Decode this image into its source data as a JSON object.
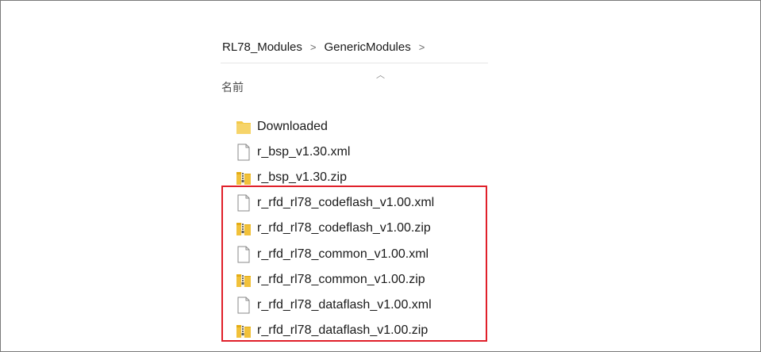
{
  "breadcrumb": {
    "items": [
      "RL78_Modules",
      "GenericModules"
    ],
    "separator": ">"
  },
  "column_header": {
    "name": "名前"
  },
  "files": [
    {
      "name": "Downloaded",
      "type": "folder"
    },
    {
      "name": "r_bsp_v1.30.xml",
      "type": "xml"
    },
    {
      "name": "r_bsp_v1.30.zip",
      "type": "zip"
    },
    {
      "name": "r_rfd_rl78_codeflash_v1.00.xml",
      "type": "xml"
    },
    {
      "name": "r_rfd_rl78_codeflash_v1.00.zip",
      "type": "zip"
    },
    {
      "name": "r_rfd_rl78_common_v1.00.xml",
      "type": "xml"
    },
    {
      "name": "r_rfd_rl78_common_v1.00.zip",
      "type": "zip"
    },
    {
      "name": "r_rfd_rl78_dataflash_v1.00.xml",
      "type": "xml"
    },
    {
      "name": "r_rfd_rl78_dataflash_v1.00.zip",
      "type": "zip"
    }
  ],
  "icons": {
    "folder": "folder-icon",
    "xml": "document-icon",
    "zip": "zip-archive-icon"
  },
  "colors": {
    "highlight_border": "#e0202a",
    "folder": "#f0c040",
    "zip": "#e9b923"
  }
}
